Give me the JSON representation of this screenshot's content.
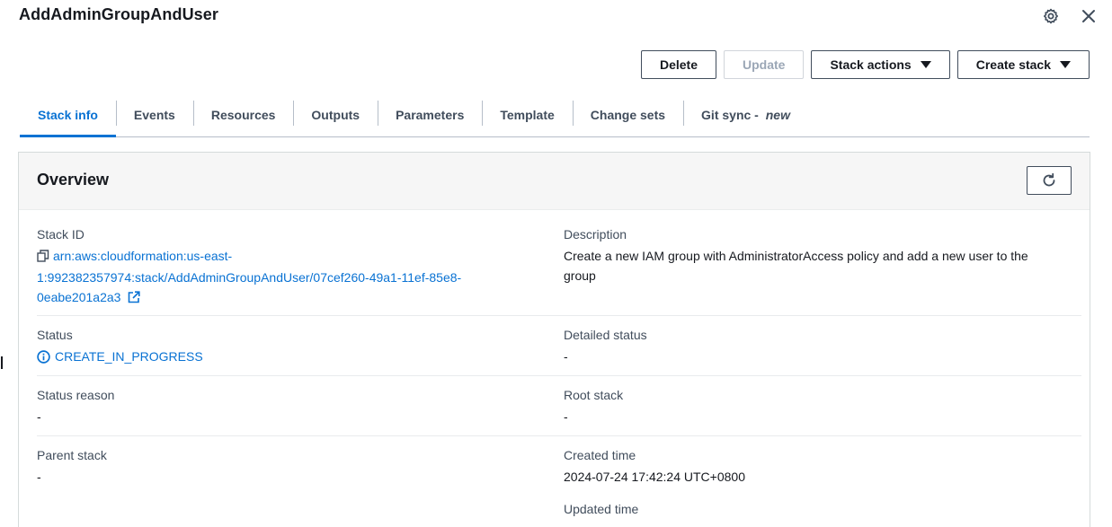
{
  "header": {
    "title": "AddAdminGroupAndUser",
    "settings_icon": "gear-icon",
    "close_icon": "close-icon"
  },
  "actions": {
    "delete_label": "Delete",
    "update_label": "Update",
    "stack_actions_label": "Stack actions",
    "create_stack_label": "Create stack"
  },
  "tabs": [
    {
      "label": "Stack info",
      "active": true
    },
    {
      "label": "Events"
    },
    {
      "label": "Resources"
    },
    {
      "label": "Outputs"
    },
    {
      "label": "Parameters"
    },
    {
      "label": "Template"
    },
    {
      "label": "Change sets"
    },
    {
      "label": "Git sync - ",
      "suffix": "new"
    }
  ],
  "overview": {
    "title": "Overview",
    "refresh_icon": "refresh-icon",
    "stack_id_label": "Stack ID",
    "stack_id_line1": "arn:aws:cloudformation:us-east-",
    "stack_id_line2": "1:992382357974:stack/AddAdminGroupAndUser/07cef260-49a1-11ef-85e8-",
    "stack_id_line3": "0eabe201a2a3",
    "description_label": "Description",
    "description_line1": "Create a new IAM group with AdministratorAccess policy and add a new user to the",
    "description_line2": "group",
    "status_label": "Status",
    "status_value": "CREATE_IN_PROGRESS",
    "detailed_status_label": "Detailed status",
    "detailed_status_value": "-",
    "status_reason_label": "Status reason",
    "status_reason_value": "-",
    "root_stack_label": "Root stack",
    "root_stack_value": "-",
    "parent_stack_label": "Parent stack",
    "parent_stack_value": "-",
    "created_time_label": "Created time",
    "created_time_value": "2024-07-24 17:42:24 UTC+0800",
    "updated_time_label": "Updated time"
  },
  "colors": {
    "accent": "#0972d3",
    "text": "#16191f",
    "muted": "#414d5c"
  }
}
